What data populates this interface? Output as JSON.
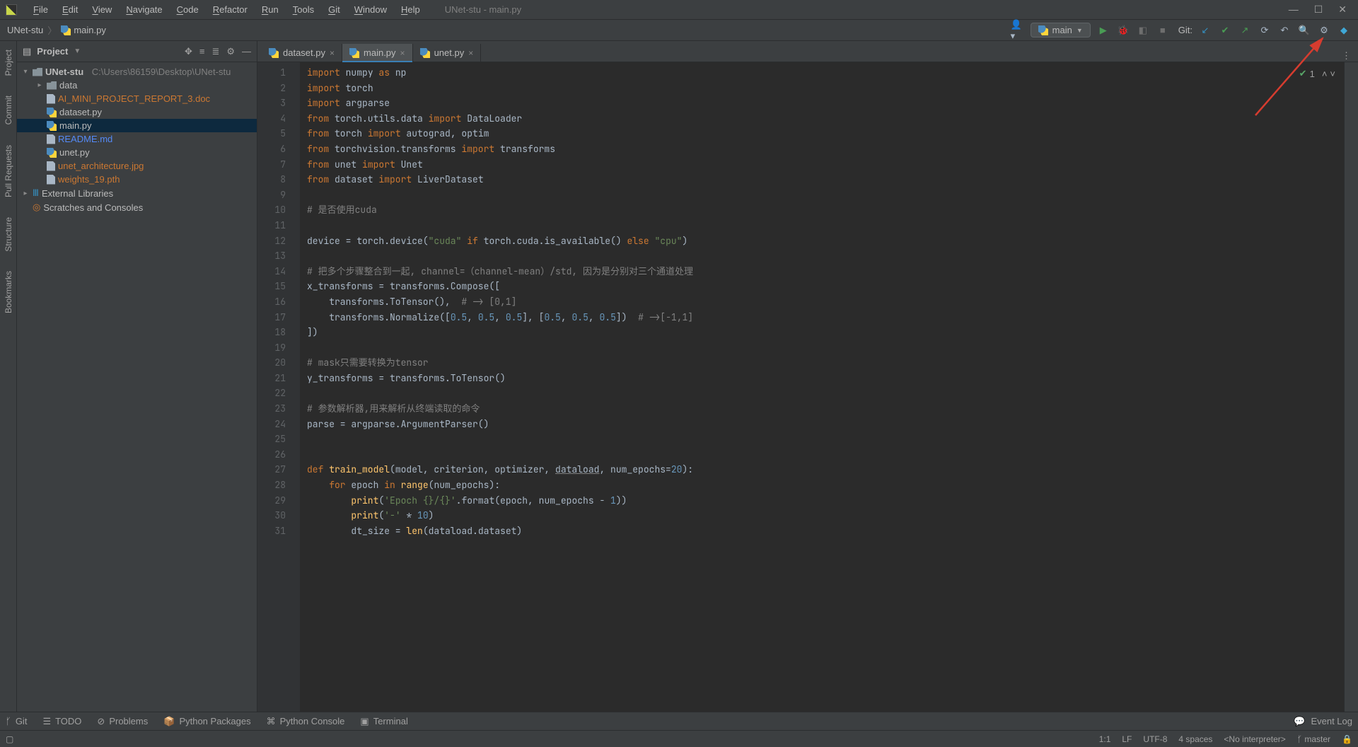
{
  "app": {
    "title": "UNet-stu - main.py"
  },
  "menus": [
    "File",
    "Edit",
    "View",
    "Navigate",
    "Code",
    "Refactor",
    "Run",
    "Tools",
    "Git",
    "Window",
    "Help"
  ],
  "breadcrumbs": {
    "project": "UNet-stu",
    "file": "main.py"
  },
  "run_config": {
    "label": "main"
  },
  "git_label": "Git:",
  "project_pane": {
    "title": "Project",
    "root": {
      "name": "UNet-stu",
      "path": "C:\\Users\\86159\\Desktop\\UNet-stu"
    },
    "items": [
      {
        "label": "data",
        "kind": "folder",
        "indent": 2,
        "expandable": true
      },
      {
        "label": "AI_MINI_PROJECT_REPORT_3.doc",
        "kind": "doc",
        "indent": 2,
        "color": "orange"
      },
      {
        "label": "dataset.py",
        "kind": "py",
        "indent": 2,
        "color": ""
      },
      {
        "label": "main.py",
        "kind": "py",
        "indent": 2,
        "selected": true
      },
      {
        "label": "README.md",
        "kind": "md",
        "indent": 2,
        "color": "blue"
      },
      {
        "label": "unet.py",
        "kind": "py",
        "indent": 2
      },
      {
        "label": "unet_architecture.jpg",
        "kind": "img",
        "indent": 2,
        "color": "orange"
      },
      {
        "label": "weights_19.pth",
        "kind": "bin",
        "indent": 2,
        "color": "orange"
      }
    ],
    "ext_lib": "External Libraries",
    "scratches": "Scratches and Consoles"
  },
  "tabs": [
    {
      "label": "dataset.py",
      "active": false
    },
    {
      "label": "main.py",
      "active": true
    },
    {
      "label": "unet.py",
      "active": false
    }
  ],
  "inspection": {
    "count": "1"
  },
  "code_lines": [
    {
      "n": 1,
      "h": "<span class='k'>import</span> numpy <span class='k'>as</span> np"
    },
    {
      "n": 2,
      "h": "<span class='k'>import</span> torch"
    },
    {
      "n": 3,
      "h": "<span class='k'>import</span> argparse"
    },
    {
      "n": 4,
      "h": "<span class='k'>from</span> torch.utils.data <span class='k'>import</span> DataLoader"
    },
    {
      "n": 5,
      "h": "<span class='k'>from</span> torch <span class='k'>import</span> autograd, optim"
    },
    {
      "n": 6,
      "h": "<span class='k'>from</span> torchvision.transforms <span class='k'>import</span> transforms"
    },
    {
      "n": 7,
      "h": "<span class='k'>from</span> unet <span class='k'>import</span> Unet"
    },
    {
      "n": 8,
      "h": "<span class='k'>from</span> dataset <span class='k'>import</span> LiverDataset"
    },
    {
      "n": 9,
      "h": ""
    },
    {
      "n": 10,
      "h": "<span class='c'># 是否使用cuda</span>"
    },
    {
      "n": 11,
      "h": ""
    },
    {
      "n": 12,
      "h": "device = torch.device(<span class='s'>\"cuda\"</span> <span class='k'>if</span> torch.cuda.is_available() <span class='k'>else</span> <span class='s'>\"cpu\"</span>)"
    },
    {
      "n": 13,
      "h": ""
    },
    {
      "n": 14,
      "h": "<span class='c'># 把多个步骤整合到一起, channel=（channel-mean）/std, 因为是分别对三个通道处理</span>"
    },
    {
      "n": 15,
      "h": "x_transforms = transforms.Compose(["
    },
    {
      "n": 16,
      "h": "    transforms.ToTensor(),  <span class='c'># -&gt; [0,1]</span>"
    },
    {
      "n": 17,
      "h": "    transforms.Normalize([<span class='n'>0.5</span>, <span class='n'>0.5</span>, <span class='n'>0.5</span>], [<span class='n'>0.5</span>, <span class='n'>0.5</span>, <span class='n'>0.5</span>])  <span class='c'># -&gt;[-1,1]</span>"
    },
    {
      "n": 18,
      "h": "])"
    },
    {
      "n": 19,
      "h": ""
    },
    {
      "n": 20,
      "h": "<span class='c'># mask只需要转换为tensor</span>"
    },
    {
      "n": 21,
      "h": "y_transforms = transforms.ToTensor()"
    },
    {
      "n": 22,
      "h": ""
    },
    {
      "n": 23,
      "h": "<span class='c'># 参数解析器,用来解析从终端读取的命令</span>"
    },
    {
      "n": 24,
      "h": "parse = argparse.ArgumentParser()"
    },
    {
      "n": 25,
      "h": ""
    },
    {
      "n": 26,
      "h": ""
    },
    {
      "n": 27,
      "h": "<span class='k'>def </span><span class='fn'>train_model</span>(model, criterion, optimizer, <span class='und'>dataload</span>, num_epochs=<span class='n'>20</span>):"
    },
    {
      "n": 28,
      "h": "    <span class='k'>for</span> epoch <span class='k'>in</span> <span class='fn'>range</span>(num_epochs):"
    },
    {
      "n": 29,
      "h": "        <span class='fn'>print</span>(<span class='s'>'Epoch {}/{}'</span>.format(epoch, num_epochs - <span class='n'>1</span>))"
    },
    {
      "n": 30,
      "h": "        <span class='fn'>print</span>(<span class='s'>'-'</span> * <span class='n'>10</span>)"
    },
    {
      "n": 31,
      "h": "        dt_size = <span class='fn'>len</span>(dataload.dataset)"
    }
  ],
  "bottom_tools": {
    "items": [
      "Git",
      "TODO",
      "Problems",
      "Python Packages",
      "Python Console",
      "Terminal"
    ],
    "event_log": "Event Log"
  },
  "status": {
    "pos": "1:1",
    "le": "LF",
    "enc": "UTF-8",
    "indent": "4 spaces",
    "interp": "<No interpreter>",
    "branch": "master"
  },
  "left_tools": [
    "Project",
    "Commit",
    "Pull Requests",
    "Structure",
    "Bookmarks"
  ]
}
